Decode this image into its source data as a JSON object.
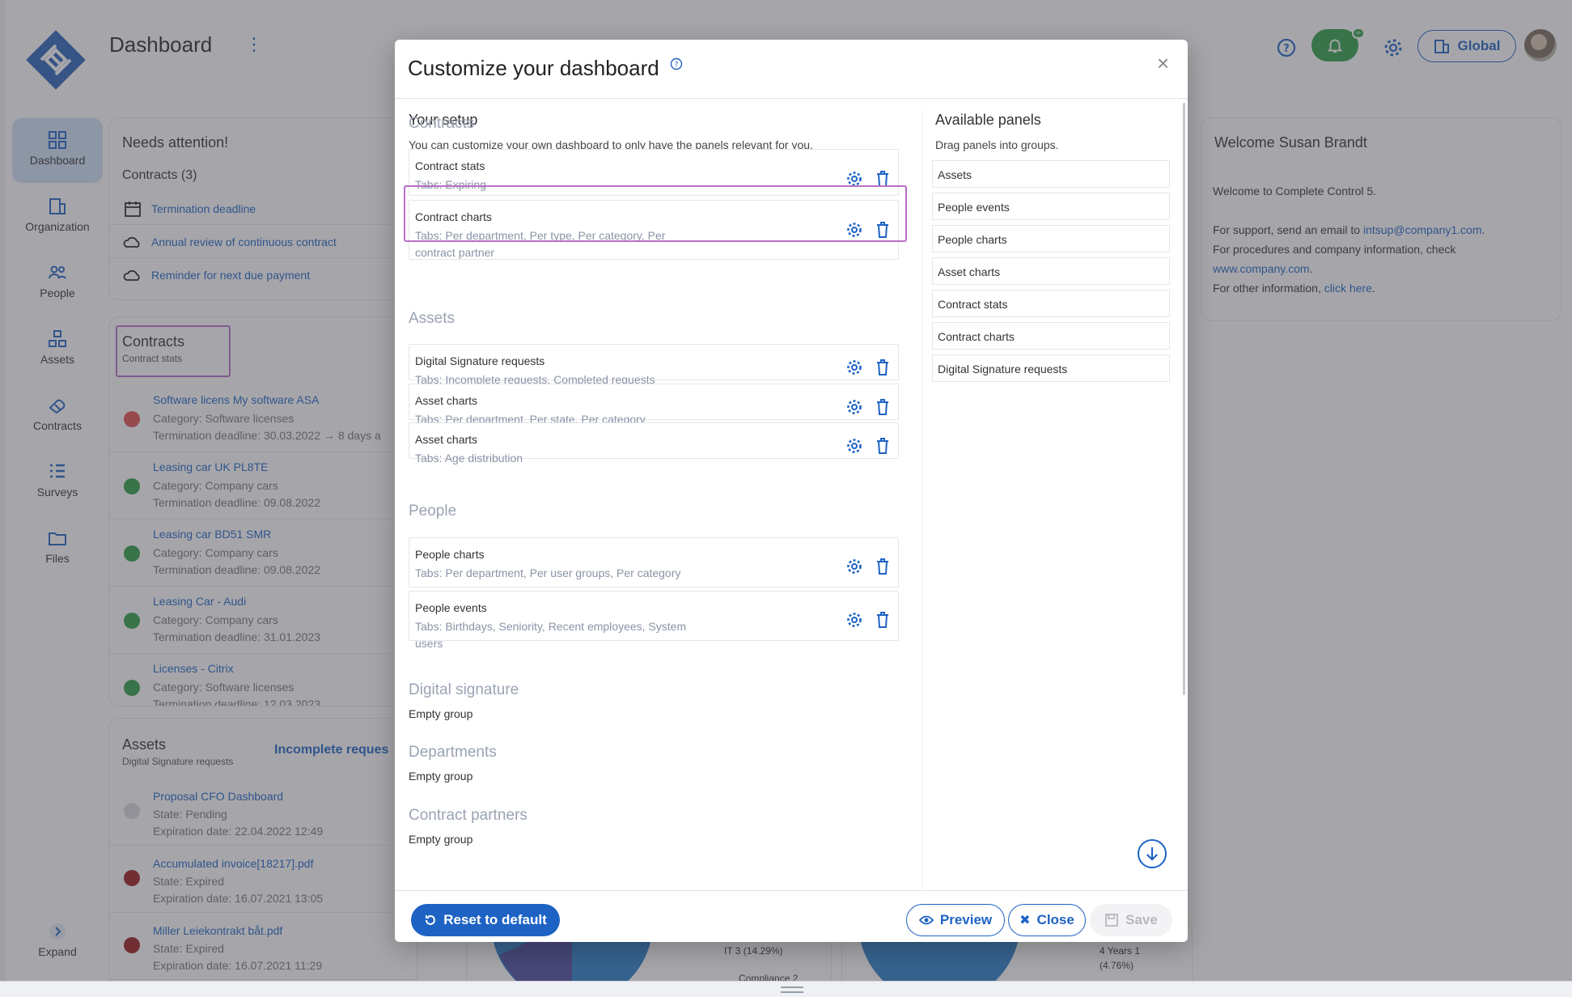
{
  "header": {
    "title": "Dashboard",
    "global_label": "Global",
    "notification_badge": "∞"
  },
  "sidebar": {
    "items": [
      {
        "label": "Dashboard",
        "icon": "grid-icon"
      },
      {
        "label": "Organization",
        "icon": "building-icon"
      },
      {
        "label": "People",
        "icon": "people-icon"
      },
      {
        "label": "Assets",
        "icon": "assets-icon"
      },
      {
        "label": "Contracts",
        "icon": "contract-icon"
      },
      {
        "label": "Surveys",
        "icon": "list-icon"
      },
      {
        "label": "Files",
        "icon": "folder-icon"
      }
    ],
    "expand_label": "Expand"
  },
  "attention": {
    "title": "Needs attention!",
    "contracts_label": "Contracts (3)",
    "items": [
      "Termination deadline",
      "Annual review of continuous contract",
      "Reminder for next due payment"
    ]
  },
  "contracts_panel": {
    "title": "Contracts",
    "subtitle": "Contract stats",
    "items": [
      {
        "name": "Software licens My software ASA",
        "category": "Category: Software licenses",
        "deadline": "Termination deadline: 30.03.2022 → 8 days a",
        "color": "#e25050"
      },
      {
        "name": "Leasing car UK PL8TE",
        "category": "Category: Company cars",
        "deadline": "Termination deadline: 09.08.2022",
        "color": "#2e9e45"
      },
      {
        "name": "Leasing car BD51 SMR",
        "category": "Category: Company cars",
        "deadline": "Termination deadline: 09.08.2022",
        "color": "#2e9e45"
      },
      {
        "name": "Leasing Car - Audi",
        "category": "Category: Company cars",
        "deadline": "Termination deadline: 31.01.2023",
        "color": "#2e9e45"
      },
      {
        "name": "Licenses - Citrix",
        "category": "Category: Software licenses",
        "deadline": "Termination deadline: 12.03.2023",
        "color": "#2e9e45"
      }
    ]
  },
  "assets_panel": {
    "title": "Assets",
    "subtitle": "Digital Signature requests",
    "tab": "Incomplete reques",
    "items": [
      {
        "name": "Proposal CFO Dashboard",
        "state": "State: Pending",
        "date": "Expiration date: 22.04.2022 12:49",
        "color": "#d8d8dc"
      },
      {
        "name": "Accumulated invoice[18217].pdf",
        "state": "State: Expired",
        "date": "Expiration date: 16.07.2021 13:05",
        "color": "#9b1c1c"
      },
      {
        "name": "Miller Leiekontrakt båt.pdf",
        "state": "State: Expired",
        "date": "Expiration date: 16.07.2021 11:29",
        "color": "#9b1c1c"
      }
    ]
  },
  "welcome": {
    "title": "Welcome Susan Brandt",
    "line1": "Welcome to Complete Control 5.",
    "support_prefix": "For support, send an email to ",
    "support_email": "intsup@company1.com",
    "support_suffix": ".",
    "procedures": "For procedures and company information, check",
    "website": "www.company.com",
    "website_suffix": ".",
    "other_prefix": "For other information, ",
    "other_link": "click here",
    "other_suffix": "."
  },
  "bg_charts": {
    "legend_a": "IT 3 (14.29%)",
    "legend_b": "Compliance 2",
    "legend_c": "4 Years 1",
    "legend_d": "(4.76%)"
  },
  "modal": {
    "title": "Customize your dashboard",
    "setup_title": "Your setup",
    "setup_desc": "You can customize your own dashboard to only have the panels relevant for you.",
    "groups": [
      {
        "name": "Contracts",
        "panels": [
          {
            "title": "Contract stats",
            "tabs": "Tabs: Expiring"
          },
          {
            "title": "Contract charts",
            "tabs": "Tabs: Per department, Per type, Per category, Per contract partner"
          }
        ]
      },
      {
        "name": "Assets",
        "panels": [
          {
            "title": "Digital Signature requests",
            "tabs": "Tabs: Incomplete requests, Completed requests"
          },
          {
            "title": "Asset charts",
            "tabs": "Tabs: Per department, Per state, Per category"
          },
          {
            "title": "Asset charts",
            "tabs": "Tabs: Age distribution"
          }
        ]
      },
      {
        "name": "People",
        "panels": [
          {
            "title": "People charts",
            "tabs": "Tabs: Per department, Per user groups, Per category"
          },
          {
            "title": "People events",
            "tabs": "Tabs: Birthdays, Seniority, Recent employees, System users"
          }
        ]
      },
      {
        "name": "Digital signature",
        "empty": "Empty group"
      },
      {
        "name": "Departments",
        "empty": "Empty group"
      },
      {
        "name": "Contract partners",
        "empty": "Empty group"
      }
    ],
    "available_title": "Available panels",
    "available_desc": "Drag panels into groups.",
    "available": [
      "Assets",
      "People events",
      "People charts",
      "Asset charts",
      "Contract stats",
      "Contract charts",
      "Digital Signature requests"
    ],
    "buttons": {
      "reset": "Reset to default",
      "preview": "Preview",
      "close": "Close",
      "save": "Save"
    }
  }
}
